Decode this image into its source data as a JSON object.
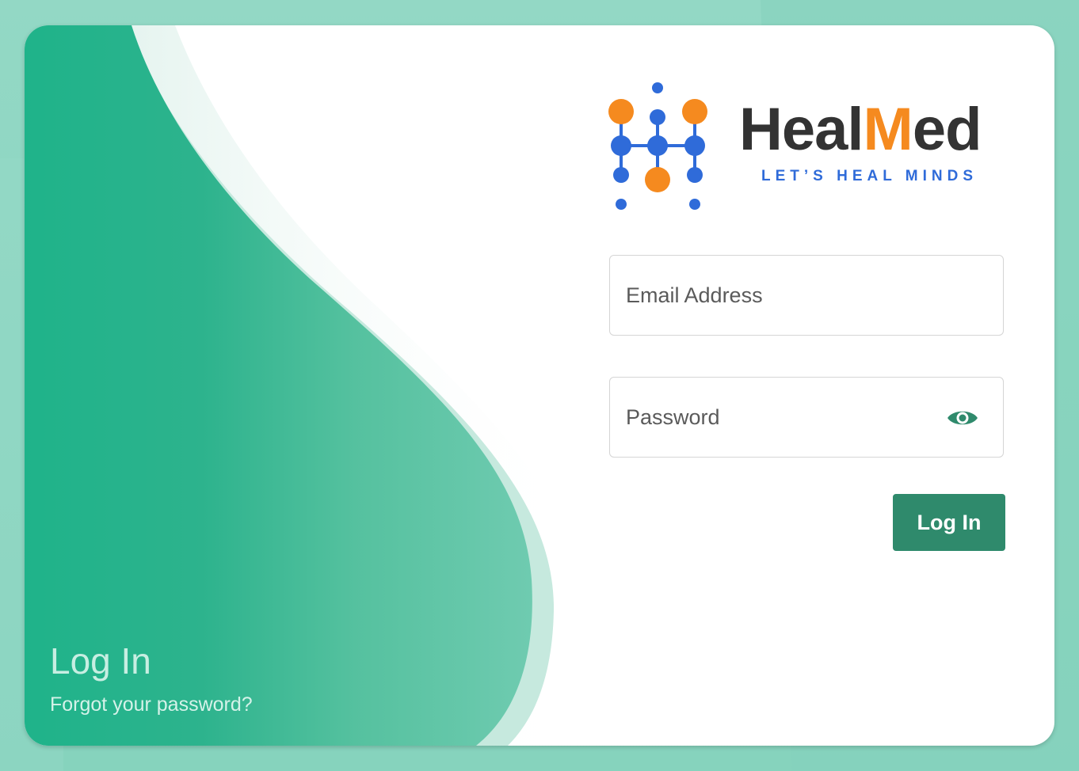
{
  "colors": {
    "page_background": "#8fd6c2",
    "wave_green": "#1fb38a",
    "wave_light": "#c5eadf",
    "button_green": "#2f8a6c",
    "brand_orange": "#f58a1f",
    "brand_blue": "#2f6bd9",
    "brand_dark": "#333333"
  },
  "left_panel": {
    "title": "Log In",
    "forgot_link": "Forgot your password?"
  },
  "logo": {
    "brand_prefix": "Heal",
    "brand_accent": "M",
    "brand_suffix": "ed",
    "tagline": "LET’S HEAL MINDS"
  },
  "form": {
    "email_placeholder": "Email Address",
    "email_value": "",
    "password_placeholder": "Password",
    "password_value": "",
    "toggle_icon": "eye-icon",
    "submit_label": "Log In"
  }
}
